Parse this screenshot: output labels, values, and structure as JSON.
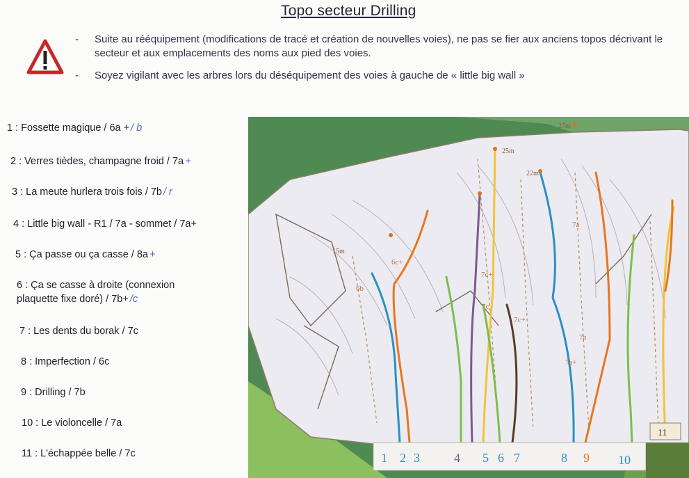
{
  "header": {
    "title": "Topo secteur Drilling"
  },
  "warning": {
    "icon": "warning-triangle-icon",
    "bullets": [
      "Suite au rééquipement (modifications de tracé et création de nouvelles voies), ne pas se fier aux anciens topos décrivant le secteur et aux emplacements des noms aux pied des voies.",
      "Soyez vigilant avec les arbres lors du déséquipement des voies à gauche de « little big wall »"
    ]
  },
  "routes": [
    {
      "label": "1 : Fossette magique / 6a +",
      "note": "/ b"
    },
    {
      "label": "2 : Verres tièdes, champagne froid / 7a",
      "note": "+"
    },
    {
      "label": "3 : La meute hurlera trois fois / 7b",
      "note": "/ r"
    },
    {
      "label": "4 : Little big wall - R1 / 7a - sommet / 7a+",
      "note": ""
    },
    {
      "label": "5 : Ça passe ou ça casse / 8a",
      "note": "+"
    },
    {
      "label": "6 : Ça se casse à droite (connexion plaquette fixe doré) / 7b+",
      "note": "/c"
    },
    {
      "label": "7 : Les dents du borak / 7c",
      "note": ""
    },
    {
      "label": "8 : Imperfection / 6c",
      "note": ""
    },
    {
      "label": "9 : Drilling / 7b",
      "note": ""
    },
    {
      "label": "10 : Le violoncelle / 7a",
      "note": ""
    },
    {
      "label": "11 : L'échappée belle / 7c",
      "note": ""
    }
  ],
  "topo": {
    "route_numbers": [
      "1",
      "2",
      "3",
      "4",
      "5",
      "6",
      "7",
      "8",
      "9",
      "10",
      "11"
    ],
    "height_labels": [
      "27m",
      "25m",
      "22m",
      "15m"
    ],
    "grade_labels": [
      "6c+",
      "6b",
      "7c+",
      "7c",
      "7c+",
      "7a",
      "7a",
      "7a+"
    ],
    "route_colors": {
      "blue": "#2b8fc4",
      "orange": "#e8761c",
      "green": "#7cbf4a",
      "yellow": "#f0c43a",
      "purple": "#7d5a8c",
      "brown": "#5a3a24"
    }
  }
}
